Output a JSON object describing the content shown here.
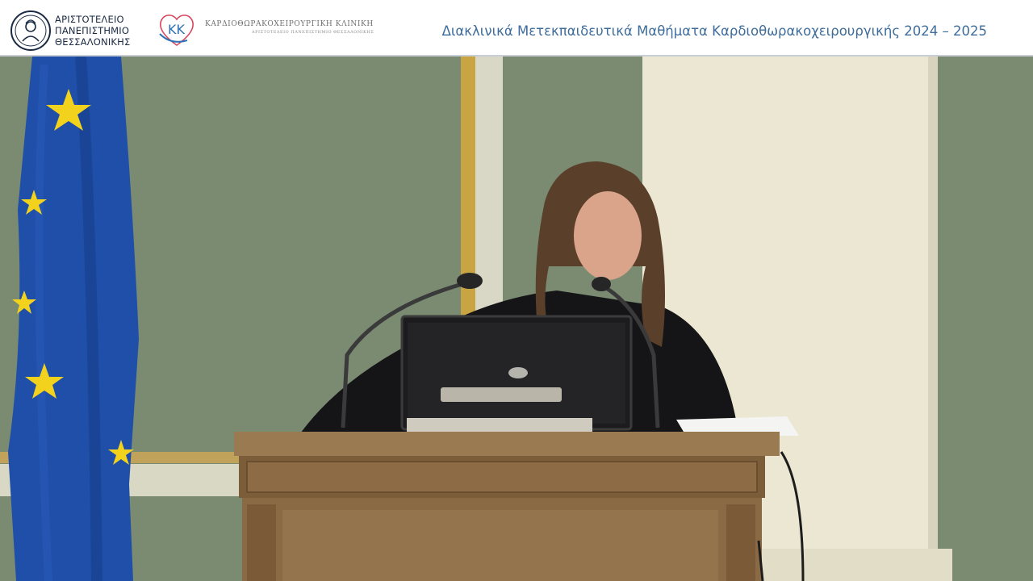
{
  "header": {
    "university_lines": [
      "ΑΡΙΣΤΟΤΕΛΕΙΟ",
      "ΠΑΝΕΠΙΣΤΗΜΙΟ",
      "ΘΕΣΣΑΛΟΝΙΚΗΣ"
    ],
    "clinic_name": "ΚΑΡΔΙΟΘΩΡΑΚΟΧΕΙΡΟΥΡΓΙΚΗ ΚΛΙΝΙΚΗ",
    "clinic_subtitle": "ΑΡΙΣΤΟΤΕΛΕΙΟ ΠΑΝΕΠΙΣΤΗΜΙΟ ΘΕΣΣΑΛΟΝΙΚΗΣ",
    "course_title": "Διακλινικά Μετεκπαιδευτικά Μαθήματα Καρδιοθωρακοχειρουργικής 2024 – 2025"
  },
  "logos": {
    "university_icon": "university-seal-icon",
    "clinic_icon": "kk-heart-logo-icon",
    "clinic_letters": "ΚΚ"
  },
  "colors": {
    "title_blue": "#3e6d9c",
    "wall_green": "#7a8b72",
    "eu_blue": "#1f4fa8",
    "eu_star": "#f2d21c",
    "podium_wood": "#8a6a44"
  }
}
